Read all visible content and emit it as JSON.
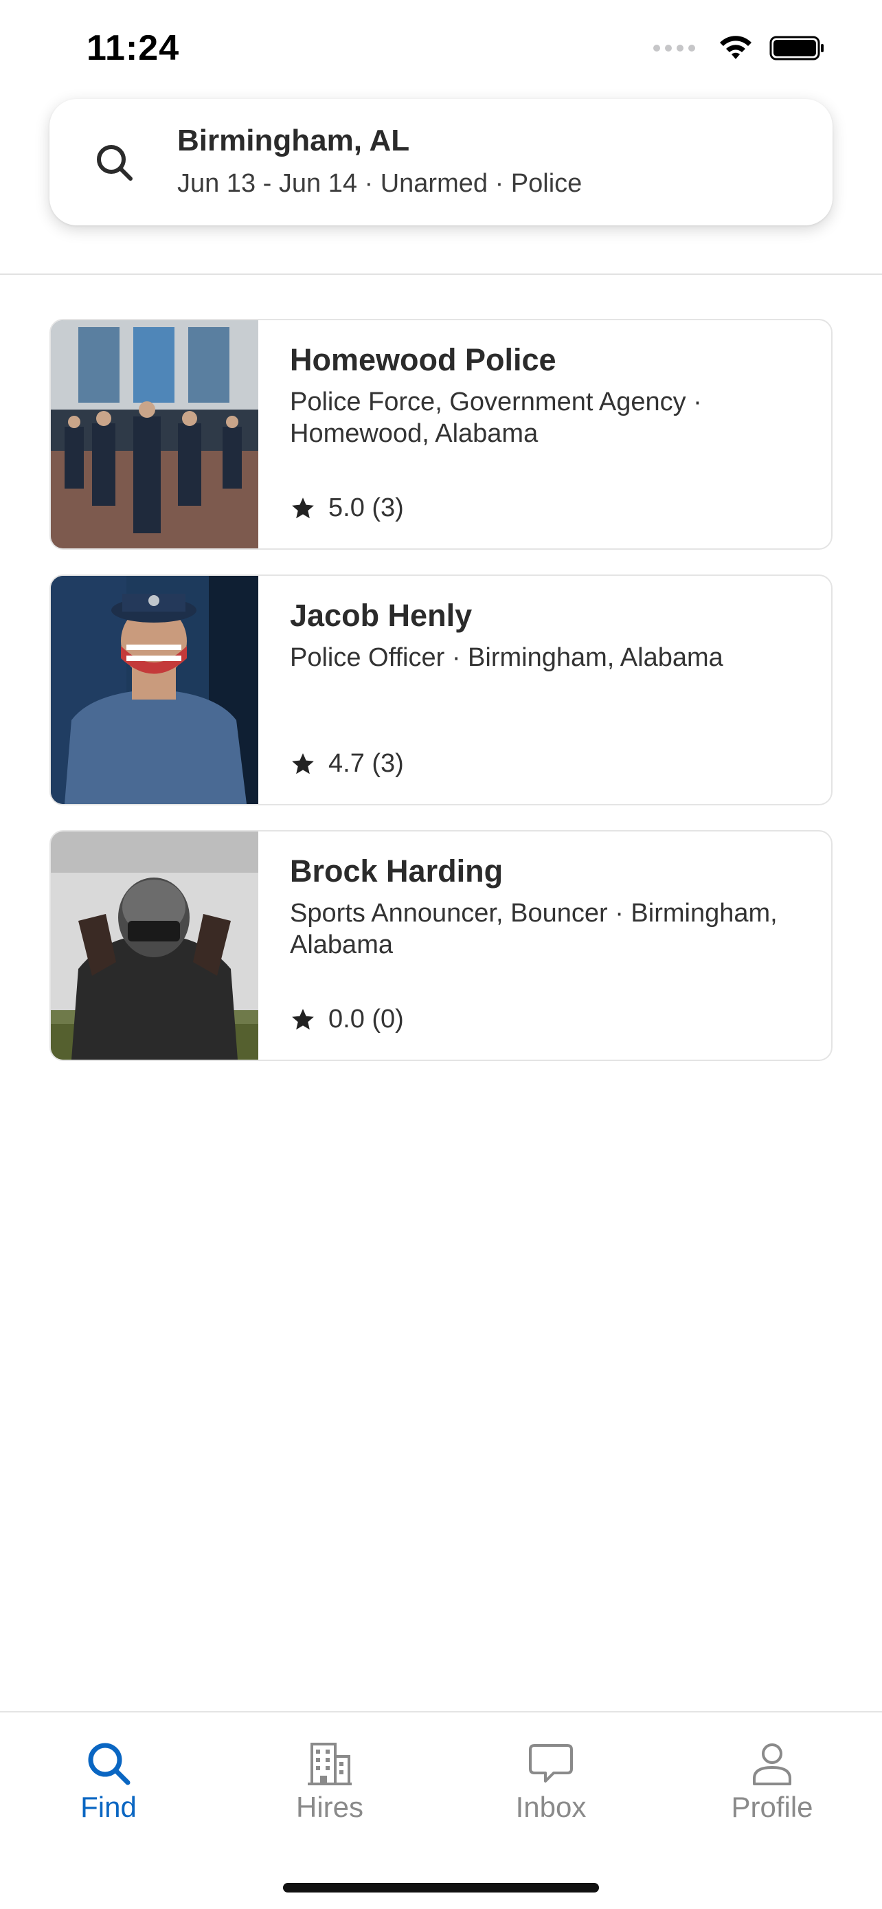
{
  "status": {
    "time": "11:24"
  },
  "search": {
    "location": "Birmingham, AL",
    "summary": "Jun 13 - Jun 14 · Unarmed · Police"
  },
  "results": [
    {
      "name": "Homewood Police",
      "description": "Police Force, Government Agency · Homewood, Alabama",
      "rating": "5.0 (3)"
    },
    {
      "name": "Jacob Henly",
      "description": "Police Officer · Birmingham, Alabama",
      "rating": "4.7 (3)"
    },
    {
      "name": "Brock Harding",
      "description": "Sports Announcer, Bouncer · Birmingham, Alabama",
      "rating": "0.0 (0)"
    }
  ],
  "tabs": [
    {
      "label": "Find",
      "icon": "search-icon",
      "active": true
    },
    {
      "label": "Hires",
      "icon": "building-icon",
      "active": false
    },
    {
      "label": "Inbox",
      "icon": "chat-bubble-icon",
      "active": false
    },
    {
      "label": "Profile",
      "icon": "person-icon",
      "active": false
    }
  ],
  "colors": {
    "accent": "#0a66c2",
    "inactive": "#8a8a8a",
    "text": "#2b2b2b"
  }
}
